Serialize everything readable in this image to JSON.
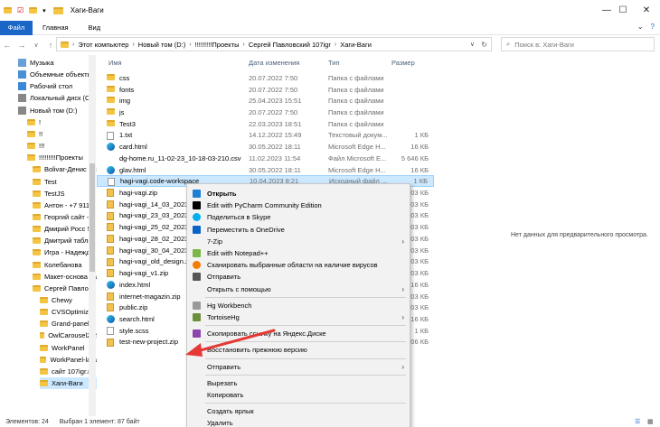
{
  "window": {
    "title": "Хаги-Ваги"
  },
  "ribbon": {
    "file": "Файл",
    "tabs": [
      "Главная",
      "Вид"
    ]
  },
  "address": {
    "path": [
      "Этот компьютер",
      "Новый том (D:)",
      "!!!!!!!!!Проекты",
      "Сергей Павловский 107igr",
      "Хаги-Ваги"
    ],
    "search_placeholder": "Поиск в: Хаги-Ваги"
  },
  "nav": {
    "items": [
      "Музыка",
      "Объемные объекты",
      "Рабочий стол",
      "Локальный диск (C",
      "Новый том (D:)",
      "!",
      "!!",
      "!!!",
      "!!!!!!!!!Проекты",
      "Bolivar-Денис мс",
      "Test",
      "TestJS",
      "Антон - +7 911 3",
      "Георгий сайт - п",
      "Дмирий Росс 50",
      "Дмитрий таблиц",
      "Игра - Надежда",
      "Колебанова",
      "Макет-основа са",
      "Сергей Павловс",
      "Chewy",
      "CVSOptimizer",
      "Grand-panel",
      "OwlCarousel2-2",
      "WorkPanel",
      "WorkPanel-lara",
      "сайт 107igr.ru",
      "Хаги-Ваги"
    ]
  },
  "columns": {
    "name": "Имя",
    "date": "Дата изменения",
    "type": "Тип",
    "size": "Размер"
  },
  "files": [
    {
      "name": "css",
      "date": "20.07.2022 7:50",
      "type": "Папка с файлами",
      "size": "",
      "icon": "folder"
    },
    {
      "name": "fonts",
      "date": "20.07.2022 7:50",
      "type": "Папка с файлами",
      "size": "",
      "icon": "folder"
    },
    {
      "name": "img",
      "date": "25.04.2023 15:51",
      "type": "Папка с файлами",
      "size": "",
      "icon": "folder"
    },
    {
      "name": "js",
      "date": "20.07.2022 7:50",
      "type": "Папка с файлами",
      "size": "",
      "icon": "folder"
    },
    {
      "name": "Test3",
      "date": "22.03.2023 18:51",
      "type": "Папка с файлами",
      "size": "",
      "icon": "folder"
    },
    {
      "name": "1.txt",
      "date": "14.12.2022 15:49",
      "type": "Текстовый докум...",
      "size": "1 КБ",
      "icon": "file"
    },
    {
      "name": "card.html",
      "date": "30.05.2022 18:11",
      "type": "Microsoft Edge H...",
      "size": "16 КБ",
      "icon": "edge"
    },
    {
      "name": "dg-home.ru_11-02-23_10-18-03-210.csv",
      "date": "11.02.2023 11:54",
      "type": "Файл Microsoft E...",
      "size": "5 646 КБ",
      "icon": "excel"
    },
    {
      "name": "glav.html",
      "date": "30.05.2022 18:11",
      "type": "Microsoft Edge H...",
      "size": "16 КБ",
      "icon": "edge"
    },
    {
      "name": "hagi-vagi.code-workspace",
      "date": "10.04.2023 8:21",
      "type": "Исходный файл ...",
      "size": "1 КБ",
      "icon": "file"
    },
    {
      "name": "hagi-vagi.zip",
      "date": "",
      "type": "",
      "size": "203 КБ",
      "icon": "zip"
    },
    {
      "name": "hagi-vagi_14_03_2023.zip",
      "date": "",
      "type": "",
      "size": "203 КБ",
      "icon": "zip"
    },
    {
      "name": "hagi-vagi_23_03_2023.zip",
      "date": "",
      "type": "",
      "size": "203 КБ",
      "icon": "zip"
    },
    {
      "name": "hagi-vagi_25_02_2023.zip",
      "date": "",
      "type": "",
      "size": "203 КБ",
      "icon": "zip"
    },
    {
      "name": "hagi-vagi_28_02_2023.zip",
      "date": "",
      "type": "",
      "size": "203 КБ",
      "icon": "zip"
    },
    {
      "name": "hagi-vagi_30_04_2023.zip",
      "date": "",
      "type": "",
      "size": "203 КБ",
      "icon": "zip"
    },
    {
      "name": "hagi-vagi_old_design.zip",
      "date": "",
      "type": "",
      "size": "203 КБ",
      "icon": "zip"
    },
    {
      "name": "hagi-vagi_v1.zip",
      "date": "",
      "type": "",
      "size": "203 КБ",
      "icon": "zip"
    },
    {
      "name": "index.html",
      "date": "",
      "type": "",
      "size": "16 КБ",
      "icon": "edge"
    },
    {
      "name": "internet-magazin.zip",
      "date": "",
      "type": "",
      "size": "203 КБ",
      "icon": "zip"
    },
    {
      "name": "public.zip",
      "date": "",
      "type": "",
      "size": "203 КБ",
      "icon": "zip"
    },
    {
      "name": "search.html",
      "date": "",
      "type": "",
      "size": "16 КБ",
      "icon": "edge"
    },
    {
      "name": "style.scss",
      "date": "",
      "type": "",
      "size": "1 КБ",
      "icon": "file"
    },
    {
      "name": "test-new-project.zip",
      "date": "",
      "type": "",
      "size": "606 КБ",
      "icon": "zip"
    }
  ],
  "context_menu": {
    "items": [
      {
        "label": "Открыть",
        "icon": "vscode-icon",
        "sub": false,
        "bold": true
      },
      {
        "label": "Edit with PyCharm Community Edition",
        "icon": "pycharm-icon",
        "sub": false
      },
      {
        "label": "Поделиться в Skype",
        "icon": "skype-icon",
        "sub": false
      },
      {
        "label": "Переместить в OneDrive",
        "icon": "onedrive-icon",
        "sub": false
      },
      {
        "label": "7-Zip",
        "icon": "",
        "sub": true
      },
      {
        "label": "Edit with Notepad++",
        "icon": "notepad-icon",
        "sub": false
      },
      {
        "label": "Сканировать выбранные области на наличие вирусов",
        "icon": "avast-icon",
        "sub": false
      },
      {
        "label": "Отправить",
        "icon": "share-icon",
        "sub": false
      },
      {
        "label": "Открыть с помощью",
        "icon": "",
        "sub": true
      },
      {
        "label": "Hg Workbench",
        "icon": "hg-icon",
        "sub": false
      },
      {
        "label": "TortoiseHg",
        "icon": "tortoise-icon",
        "sub": true
      },
      {
        "label": "Скопировать ссылку на Яндекс.Диске",
        "icon": "yandex-disk-icon",
        "sub": false
      },
      {
        "label": "Восстановить прежнюю версию",
        "icon": "",
        "sub": false
      },
      {
        "label": "Отправить",
        "icon": "",
        "sub": true
      },
      {
        "label": "Вырезать",
        "icon": "",
        "sub": false
      },
      {
        "label": "Копировать",
        "icon": "",
        "sub": false
      },
      {
        "label": "Создать ярлык",
        "icon": "",
        "sub": false
      },
      {
        "label": "Удалить",
        "icon": "",
        "sub": false
      }
    ]
  },
  "preview": {
    "empty": "Нет данных для предварительного просмотра."
  },
  "status": {
    "count": "Элементов: 24",
    "selected": "Выбран 1 элемент: 87 байт"
  },
  "colors": {
    "accent": "#1a66c6",
    "selection": "#cce8ff",
    "arrow": "#e53935"
  }
}
